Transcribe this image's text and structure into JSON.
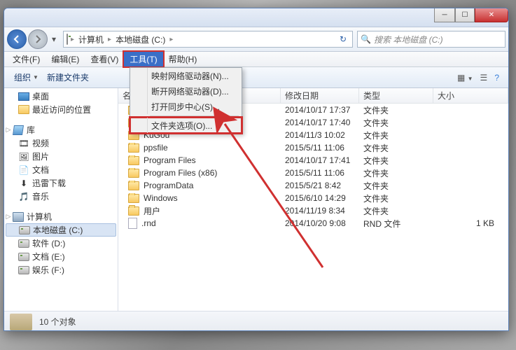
{
  "titlebar": {
    "min": "─",
    "max": "☐",
    "close": "✕"
  },
  "nav": {
    "back": "←",
    "fwd": "→",
    "dd": "▾",
    "path": {
      "seg1": "计算机",
      "seg2": "本地磁盘 (C:)"
    },
    "refresh": "↻"
  },
  "search": {
    "placeholder": "搜索 本地磁盘 (C:)",
    "icon": "🔍"
  },
  "menu": {
    "file": "文件(F)",
    "edit": "编辑(E)",
    "view": "查看(V)",
    "tools": "工具(T)",
    "help": "帮助(H)"
  },
  "tools_menu": {
    "map_drive": "映射网络驱动器(N)...",
    "disconnect": "断开网络驱动器(D)...",
    "sync_center": "打开同步中心(S)...",
    "folder_options": "文件夹选项(O)..."
  },
  "toolbar": {
    "organize": "组织",
    "new_folder": "新建文件夹",
    "view_icon": "☰",
    "details_icon": "▦",
    "help_icon": "?"
  },
  "tree": {
    "desktop": "桌面",
    "recent": "最近访问的位置",
    "libraries": "库",
    "video": "视频",
    "pictures": "图片",
    "documents": "文档",
    "thunder": "迅雷下载",
    "music": "音乐",
    "computer": "计算机",
    "drive_c": "本地磁盘 (C:)",
    "drive_d": "软件 (D:)",
    "drive_e": "文档 (E:)",
    "drive_f": "娱乐 (F:)"
  },
  "columns": {
    "name": "名称",
    "date": "修改日期",
    "type": "类型",
    "size": "大小"
  },
  "rows": [
    {
      "name": "",
      "date": "2014/10/17 17:37",
      "type": "文件夹",
      "size": "",
      "kind": "folder"
    },
    {
      "name": "",
      "date": "2014/10/17 17:40",
      "type": "文件夹",
      "size": "",
      "kind": "folder"
    },
    {
      "name": "KuGou",
      "date": "2014/11/3 10:02",
      "type": "文件夹",
      "size": "",
      "kind": "folder"
    },
    {
      "name": "ppsfile",
      "date": "2015/5/11 11:06",
      "type": "文件夹",
      "size": "",
      "kind": "folder"
    },
    {
      "name": "Program Files",
      "date": "2014/10/17 17:41",
      "type": "文件夹",
      "size": "",
      "kind": "folder"
    },
    {
      "name": "Program Files (x86)",
      "date": "2015/5/11 11:06",
      "type": "文件夹",
      "size": "",
      "kind": "folder"
    },
    {
      "name": "ProgramData",
      "date": "2015/5/21 8:42",
      "type": "文件夹",
      "size": "",
      "kind": "folder"
    },
    {
      "name": "Windows",
      "date": "2015/6/10 14:29",
      "type": "文件夹",
      "size": "",
      "kind": "folder"
    },
    {
      "name": "用户",
      "date": "2014/11/19 8:34",
      "type": "文件夹",
      "size": "",
      "kind": "folder"
    },
    {
      "name": ".rnd",
      "date": "2014/10/20 9:08",
      "type": "RND 文件",
      "size": "1 KB",
      "kind": "file"
    }
  ],
  "status": {
    "count": "10 个对象"
  }
}
